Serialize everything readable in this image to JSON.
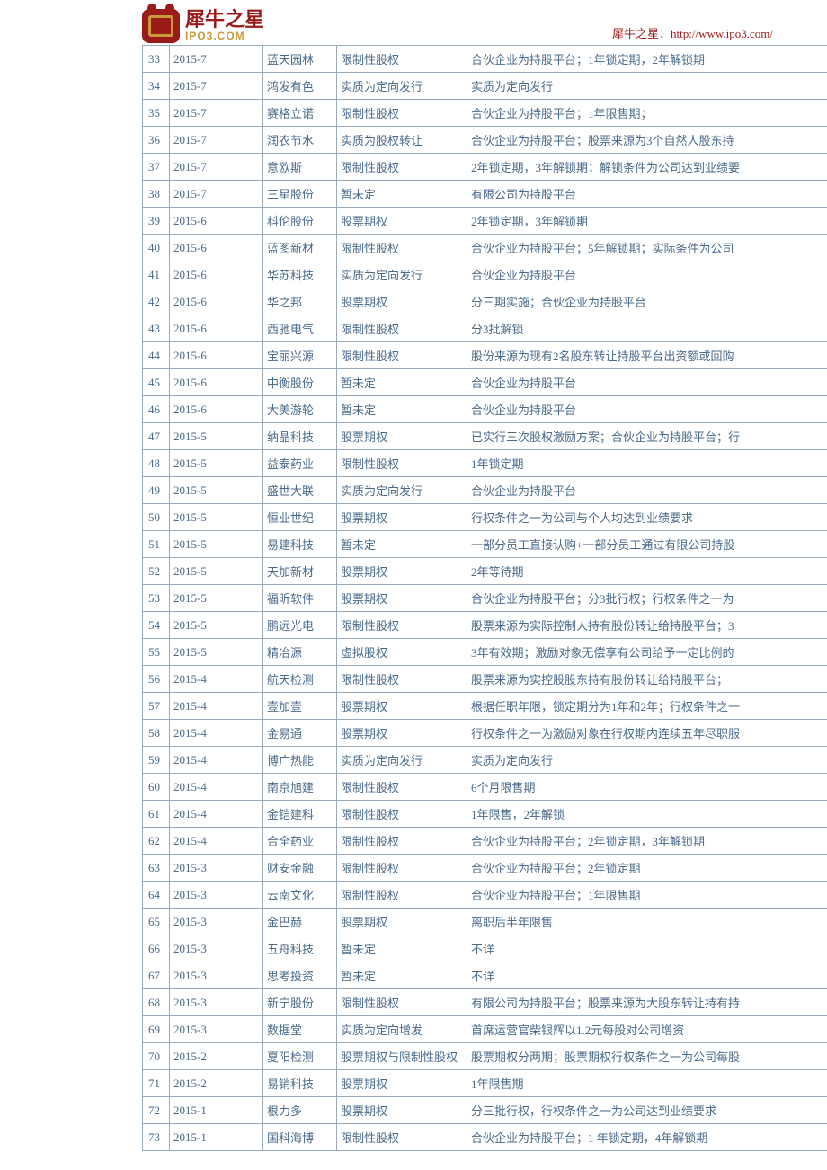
{
  "header": {
    "logo_cn": "犀牛之星",
    "logo_en": "IPO3.COM",
    "url_label": "犀牛之星：http://www.ipo3.com/"
  },
  "rows": [
    {
      "no": "33",
      "date": "2015-7",
      "name": "蓝天园林",
      "type": "限制性股权",
      "note": "合伙企业为持股平台；1年锁定期，2年解锁期"
    },
    {
      "no": "34",
      "date": "2015-7",
      "name": "鸿发有色",
      "type": "实质为定向发行",
      "note": "实质为定向发行"
    },
    {
      "no": "35",
      "date": "2015-7",
      "name": "赛格立诺",
      "type": "限制性股权",
      "note": "合伙企业为持股平台；1年限售期；"
    },
    {
      "no": "36",
      "date": "2015-7",
      "name": "润农节水",
      "type": "实质为股权转让",
      "note": "合伙企业为持股平台；股票来源为3个自然人股东持"
    },
    {
      "no": "37",
      "date": "2015-7",
      "name": "意欧斯",
      "type": "限制性股权",
      "note": "2年锁定期，3年解锁期；解锁条件为公司达到业绩要"
    },
    {
      "no": "38",
      "date": "2015-7",
      "name": "三星股份",
      "type": "暂未定",
      "note": "有限公司为持股平台"
    },
    {
      "no": "39",
      "date": "2015-6",
      "name": "科伦股份",
      "type": "股票期权",
      "note": "2年锁定期，3年解锁期"
    },
    {
      "no": "40",
      "date": "2015-6",
      "name": "蓝图新材",
      "type": "限制性股权",
      "note": "合伙企业为持股平台；5年解锁期；实际条件为公司"
    },
    {
      "no": "41",
      "date": "2015-6",
      "name": "华苏科技",
      "type": "实质为定向发行",
      "note": "合伙企业为持股平台"
    },
    {
      "no": "42",
      "date": "2015-6",
      "name": "华之邦",
      "type": "股票期权",
      "note": "分三期实施；合伙企业为持股平台"
    },
    {
      "no": "43",
      "date": "2015-6",
      "name": "西驰电气",
      "type": "限制性股权",
      "note": "分3批解锁"
    },
    {
      "no": "44",
      "date": "2015-6",
      "name": "宝丽兴源",
      "type": "限制性股权",
      "note": "股份来源为现有2名股东转让持股平台出资额或回购"
    },
    {
      "no": "45",
      "date": "2015-6",
      "name": "中衡股份",
      "type": "暂未定",
      "note": "合伙企业为持股平台"
    },
    {
      "no": "46",
      "date": "2015-6",
      "name": "大美游轮",
      "type": "暂未定",
      "note": "合伙企业为持股平台"
    },
    {
      "no": "47",
      "date": "2015-5",
      "name": "纳晶科技",
      "type": "股票期权",
      "note": "已实行三次股权激励方案；合伙企业为持股平台；行"
    },
    {
      "no": "48",
      "date": "2015-5",
      "name": "益泰药业",
      "type": "限制性股权",
      "note": "1年锁定期"
    },
    {
      "no": "49",
      "date": "2015-5",
      "name": "盛世大联",
      "type": "实质为定向发行",
      "note": "合伙企业为持股平台"
    },
    {
      "no": "50",
      "date": "2015-5",
      "name": "恒业世纪",
      "type": "股票期权",
      "note": "行权条件之一为公司与个人均达到业绩要求"
    },
    {
      "no": "51",
      "date": "2015-5",
      "name": "易建科技",
      "type": "暂未定",
      "note": "一部分员工直接认购+一部分员工通过有限公司持股"
    },
    {
      "no": "52",
      "date": "2015-5",
      "name": "天加新材",
      "type": "股票期权",
      "note": "2年等待期"
    },
    {
      "no": "53",
      "date": "2015-5",
      "name": "福昕软件",
      "type": "股票期权",
      "note": "合伙企业为持股平台；分3批行权；行权条件之一为"
    },
    {
      "no": "54",
      "date": "2015-5",
      "name": "鹏远光电",
      "type": "限制性股权",
      "note": "股票来源为实际控制人持有股份转让给持股平台；3"
    },
    {
      "no": "55",
      "date": "2015-5",
      "name": "精冶源",
      "type": "虚拟股权",
      "note": "3年有效期；激励对象无偿享有公司给予一定比例的"
    },
    {
      "no": "56",
      "date": "2015-4",
      "name": "航天检测",
      "type": "限制性股权",
      "note": "股票来源为实控股股东持有股份转让给持股平台；"
    },
    {
      "no": "57",
      "date": "2015-4",
      "name": "壹加壹",
      "type": "股票期权",
      "note": "根据任职年限，锁定期分为1年和2年；行权条件之一"
    },
    {
      "no": "58",
      "date": "2015-4",
      "name": "金易通",
      "type": "股票期权",
      "note": "行权条件之一为激励对象在行权期内连续五年尽职服"
    },
    {
      "no": "59",
      "date": "2015-4",
      "name": "博广热能",
      "type": "实质为定向发行",
      "note": "实质为定向发行"
    },
    {
      "no": "60",
      "date": "2015-4",
      "name": "南京旭建",
      "type": "限制性股权",
      "note": "6个月限售期"
    },
    {
      "no": "61",
      "date": "2015-4",
      "name": "金铠建科",
      "type": "限制性股权",
      "note": "1年限售，2年解锁"
    },
    {
      "no": "62",
      "date": "2015-4",
      "name": "合全药业",
      "type": "限制性股权",
      "note": "合伙企业为持股平台；2年锁定期，3年解锁期"
    },
    {
      "no": "63",
      "date": "2015-3",
      "name": "财安金融",
      "type": "限制性股权",
      "note": "合伙企业为持股平台；2年锁定期"
    },
    {
      "no": "64",
      "date": "2015-3",
      "name": "云南文化",
      "type": "限制性股权",
      "note": "合伙企业为持股平台；1年限售期"
    },
    {
      "no": "65",
      "date": "2015-3",
      "name": "金巴赫",
      "type": "股票期权",
      "note": "离职后半年限售"
    },
    {
      "no": "66",
      "date": "2015-3",
      "name": "五舟科技",
      "type": "暂未定",
      "note": "不详"
    },
    {
      "no": "67",
      "date": "2015-3",
      "name": "思考投资",
      "type": "暂未定",
      "note": "不详"
    },
    {
      "no": "68",
      "date": "2015-3",
      "name": "新宁股份",
      "type": "限制性股权",
      "note": "有限公司为持股平台；股票来源为大股东转让持有持"
    },
    {
      "no": "69",
      "date": "2015-3",
      "name": "数据堂",
      "type": "实质为定向增发",
      "note": "首席运营官柴银辉以1.2元每股对公司增资"
    },
    {
      "no": "70",
      "date": "2015-2",
      "name": "夏阳检测",
      "type": "股票期权与限制性股权",
      "note": "股票期权分两期；股票期权行权条件之一为公司每股"
    },
    {
      "no": "71",
      "date": "2015-2",
      "name": "易销科技",
      "type": "股票期权",
      "note": "1年限售期"
    },
    {
      "no": "72",
      "date": "2015-1",
      "name": "根力多",
      "type": "股票期权",
      "note": "分三批行权，行权条件之一为公司达到业绩要求"
    },
    {
      "no": "73",
      "date": "2015-1",
      "name": "国科海博",
      "type": "限制性股权",
      "note": "合伙企业为持股平台；1 年锁定期，4年解锁期"
    }
  ]
}
